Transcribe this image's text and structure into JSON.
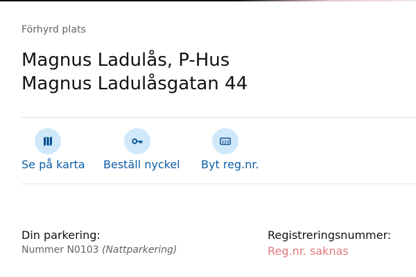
{
  "header": {
    "kicker": "Förhyrd plats",
    "title_line1": "Magnus Ladulås, P-Hus",
    "title_line2": "Magnus Ladulåsgatan 44"
  },
  "actions": [
    {
      "label": "Se på karta",
      "icon": "map-icon"
    },
    {
      "label": "Beställ nyckel",
      "icon": "key-icon"
    },
    {
      "label": "Byt reg.nr.",
      "icon": "license-plate-icon"
    }
  ],
  "parking": {
    "label": "Din parkering:",
    "number": "Nummer N0103",
    "type": "(Nattparkering)"
  },
  "registration": {
    "label": "Registreringsnummer:",
    "value": "Reg.nr. saknas"
  },
  "colors": {
    "link": "#0b5ea8",
    "icon_bg": "#cfe9fb",
    "missing": "#e07a7a",
    "muted": "#5f6368",
    "divider": "#e3e3e3"
  }
}
